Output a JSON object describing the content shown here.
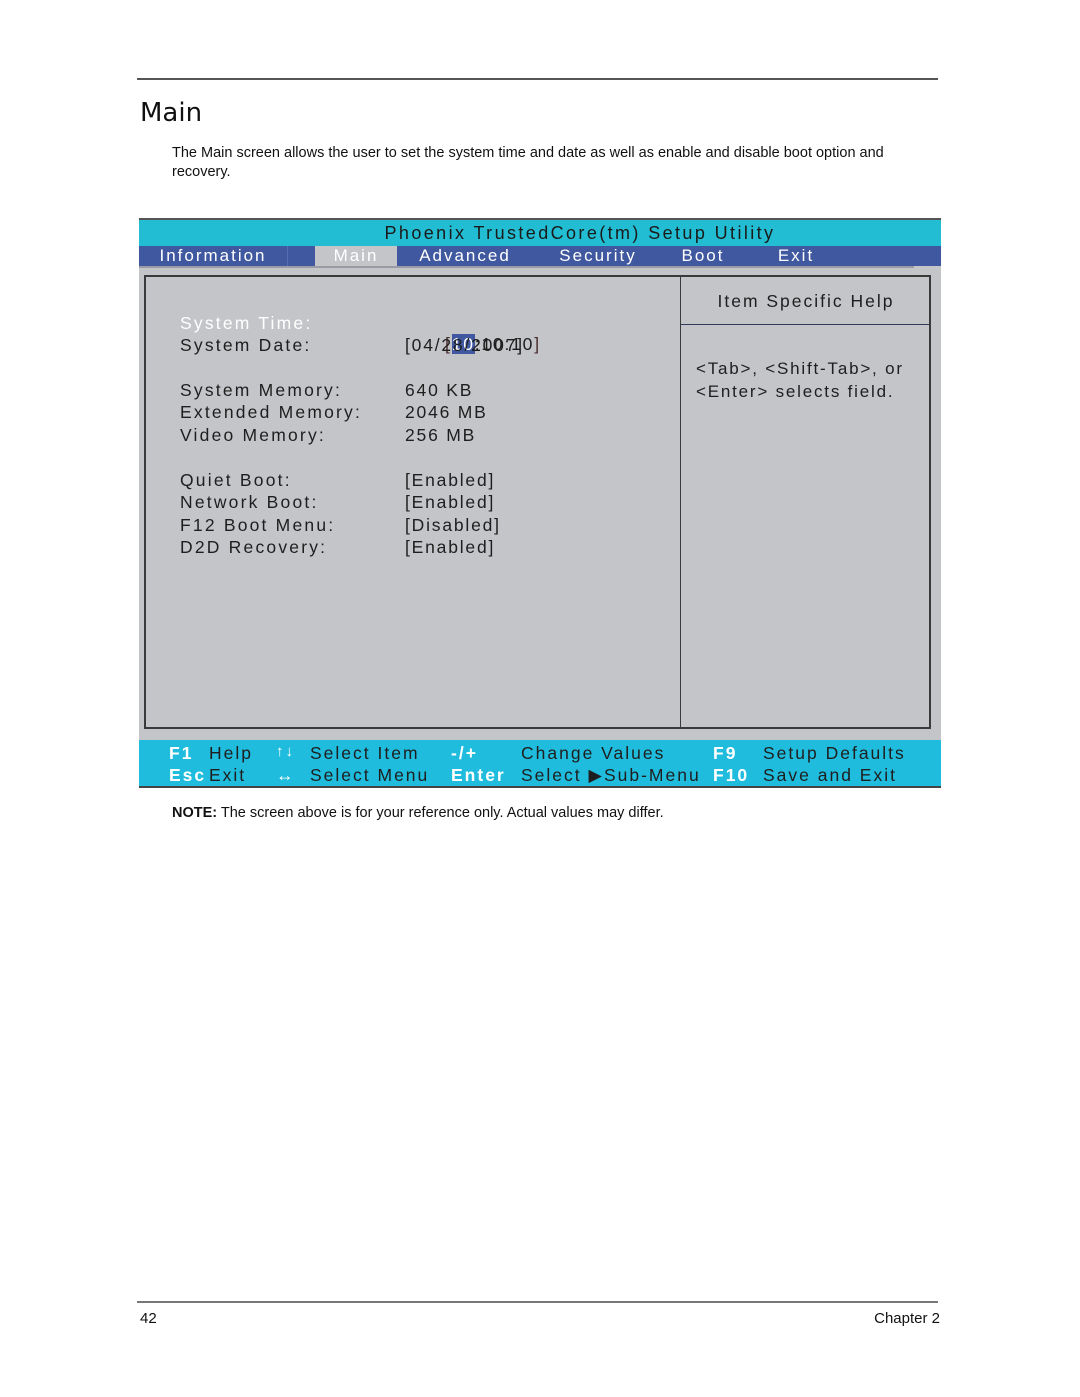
{
  "document": {
    "section_title": "Main",
    "intro": "The Main screen allows the user to set the system time and date as well as enable and disable boot option and recovery.",
    "note_label": "NOTE:",
    "note_text": " The screen above is for your reference only. Actual values may differ.",
    "page_number": "42",
    "chapter": "Chapter 2"
  },
  "bios": {
    "title": "Phoenix TrustedCore(tm) Setup Utility",
    "tabs": [
      {
        "label": "Information",
        "active": false
      },
      {
        "label": "Main",
        "active": true
      },
      {
        "label": "Advanced",
        "active": false
      },
      {
        "label": "Security",
        "active": false
      },
      {
        "label": "Boot",
        "active": false
      },
      {
        "label": "Exit",
        "active": false
      }
    ],
    "items": [
      {
        "label": "System Time:",
        "value_prefix": "[",
        "value_highlight": "10",
        "value": ":10:10",
        "value_suffix": "]",
        "selected": true
      },
      {
        "label": "System Date:",
        "value": "[04/28/2007]"
      },
      {
        "label": "System Memory:",
        "value": "640 KB"
      },
      {
        "label": "Extended Memory:",
        "value": "2046 MB"
      },
      {
        "label": "Video Memory:",
        "value": "256 MB"
      },
      {
        "label": "Quiet Boot:",
        "value": "[Enabled]"
      },
      {
        "label": "Network Boot:",
        "value": "[Enabled]"
      },
      {
        "label": "F12 Boot Menu:",
        "value": "[Disabled]"
      },
      {
        "label": "D2D Recovery:",
        "value": "[Enabled]"
      }
    ],
    "help": {
      "title": "Item Specific Help",
      "line1": "<Tab>, <Shift-Tab>, or",
      "line2": "<Enter> selects field."
    },
    "footer": {
      "row1": [
        {
          "key": "F1",
          "action": "Help"
        },
        {
          "key": "↑↓",
          "action": "Select Item"
        },
        {
          "key": "-/+",
          "action": "Change Values"
        },
        {
          "key": "F9",
          "action": "Setup Defaults"
        }
      ],
      "row2": [
        {
          "key": "Esc",
          "action": "Exit"
        },
        {
          "key": "↔",
          "action": "Select Menu"
        },
        {
          "key": "Enter",
          "action": "Select ▶Sub-Menu"
        },
        {
          "key": "F10",
          "action": "Save and Exit"
        }
      ]
    },
    "colors": {
      "title_bar": "#22bdd2",
      "menu_bar": "#3f58a0",
      "panel_bg": "#c4c5c9",
      "footer_bar": "#1fbcdd"
    }
  }
}
